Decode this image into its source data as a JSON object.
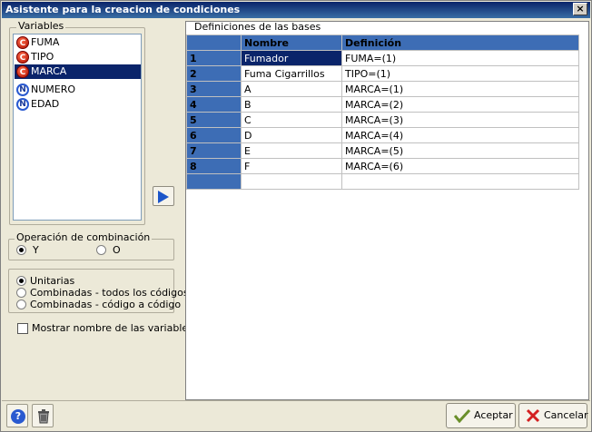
{
  "window": {
    "title": "Asistente para la creacion de condiciones",
    "close": "×"
  },
  "variables": {
    "label": "Variables",
    "items": [
      {
        "badge": "C",
        "name": "FUMA",
        "kind": "c"
      },
      {
        "badge": "C",
        "name": "TIPO",
        "kind": "c"
      },
      {
        "badge": "C",
        "name": "MARCA",
        "kind": "c"
      },
      {
        "badge": "N",
        "name": "NUMERO",
        "kind": "n"
      },
      {
        "badge": "N",
        "name": "EDAD",
        "kind": "n"
      }
    ]
  },
  "combination": {
    "label": "Operación de combinación",
    "opt_y": "Y",
    "opt_o": "O"
  },
  "mode": {
    "unitarias": "Unitarias",
    "combinadas_todos": "Combinadas - todos los códigos",
    "combinadas_codigo": "Combinadas - código a código"
  },
  "show_names": "Mostrar nombre de las variables",
  "definitions": {
    "label": "Definiciones de las bases",
    "headers": [
      "",
      "Nombre",
      "Definición"
    ],
    "rows": [
      {
        "n": "1",
        "nombre": "Fumador",
        "definicion": "FUMA=(1)"
      },
      {
        "n": "2",
        "nombre": "Fuma Cigarrillos",
        "definicion": "TIPO=(1)"
      },
      {
        "n": "3",
        "nombre": "A",
        "definicion": "MARCA=(1)"
      },
      {
        "n": "4",
        "nombre": "B",
        "definicion": "MARCA=(2)"
      },
      {
        "n": "5",
        "nombre": "C",
        "definicion": "MARCA=(3)"
      },
      {
        "n": "6",
        "nombre": "D",
        "definicion": "MARCA=(4)"
      },
      {
        "n": "7",
        "nombre": "E",
        "definicion": "MARCA=(5)"
      },
      {
        "n": "8",
        "nombre": "F",
        "definicion": "MARCA=(6)"
      }
    ]
  },
  "buttons": {
    "aceptar": "Aceptar",
    "cancelar": "Cancelar",
    "help": "?"
  }
}
